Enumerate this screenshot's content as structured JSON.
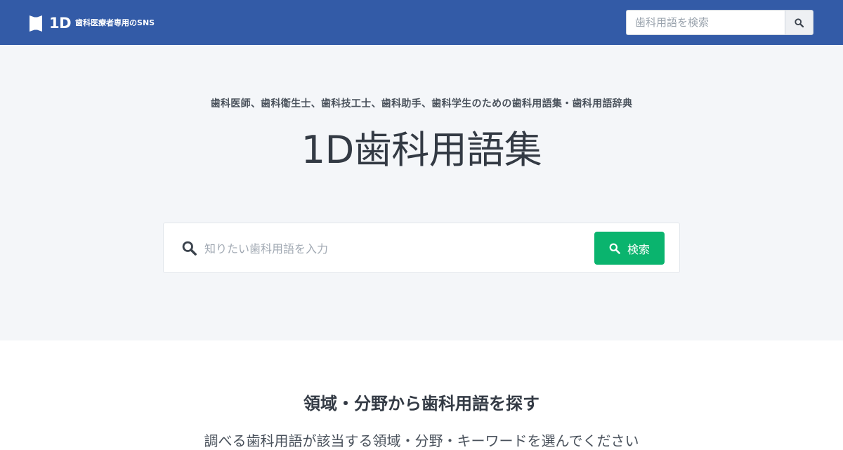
{
  "header": {
    "logo_text": "1D",
    "tagline": "歯科医療者専用のSNS",
    "search": {
      "placeholder": "歯科用語を検索"
    }
  },
  "hero": {
    "subtitle": "歯科医師、歯科衛生士、歯科技工士、歯科助手、歯科学生のための歯科用語集・歯科用語辞典",
    "title": "1D歯科用語集",
    "search": {
      "placeholder": "知りたい歯科用語を入力",
      "button_label": "検索"
    }
  },
  "section": {
    "title": "領域・分野から歯科用語を探す",
    "description": "調べる歯科用語が該当する領域・分野・キーワードを選んでください"
  },
  "colors": {
    "header_bg": "#335ba7",
    "hero_bg": "#f4f6f9",
    "primary_button": "#0ab46e"
  },
  "icons": {
    "logo": "bookmark-flag-icon",
    "header_search": "search-icon",
    "hero_search": "search-icon",
    "button_search": "search-icon"
  }
}
